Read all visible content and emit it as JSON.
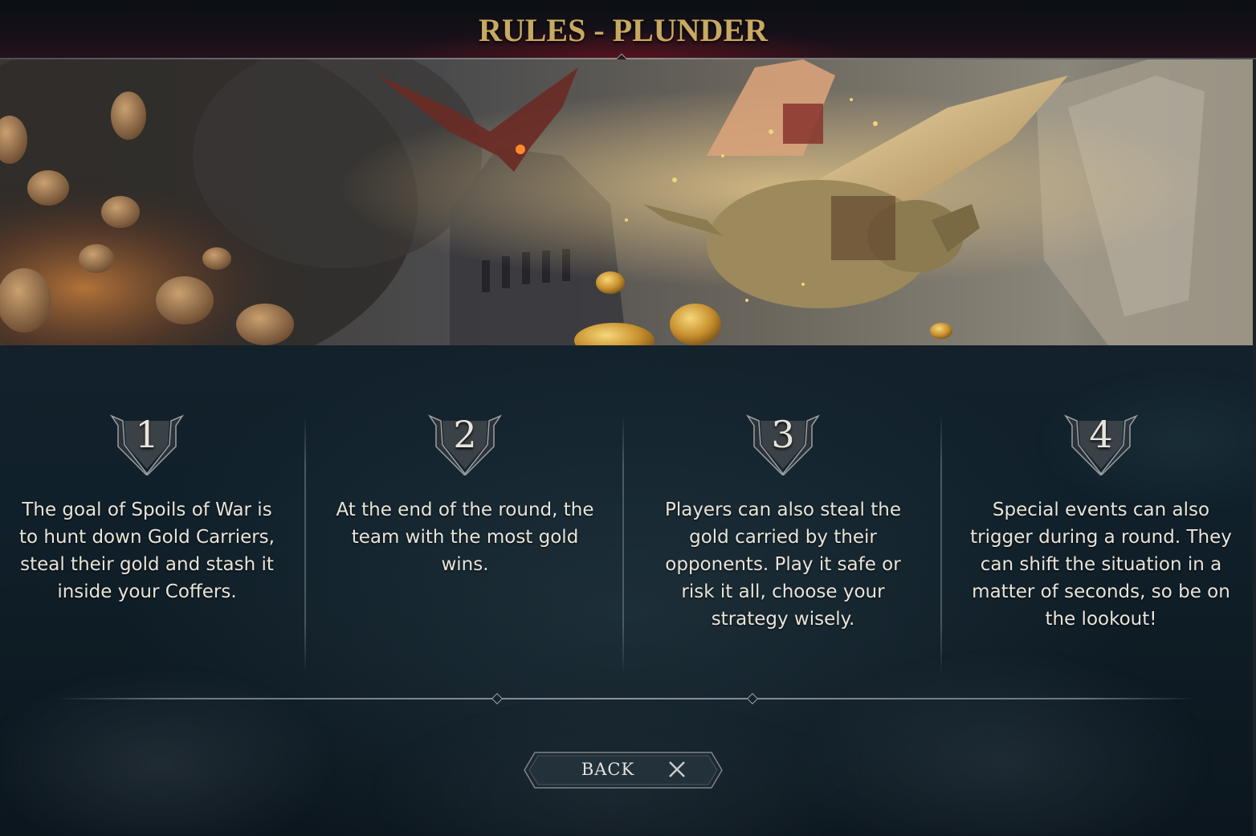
{
  "header": {
    "title": "RULES - PLUNDER"
  },
  "banner": {
    "description_icon": "dragon-gold-raid-art"
  },
  "rules": [
    {
      "number": "1",
      "text": "The goal of Spoils of War is to hunt down Gold Carriers, steal their gold and stash it inside your Coffers."
    },
    {
      "number": "2",
      "text": "At the end of the round, the team with the most gold wins."
    },
    {
      "number": "3",
      "text": "Players can also steal the gold carried by their opponents. Play it safe or risk it all, choose your strategy wisely."
    },
    {
      "number": "4",
      "text": "Special events can also trigger during a round. They can shift the situation in a matter of seconds, so be on the lookout!"
    }
  ],
  "footer": {
    "back_label": "BACK",
    "back_icon": "close-x-icon"
  },
  "colors": {
    "title_gold": "#c9a961",
    "text": "#e8e4da",
    "background": "#13212b"
  }
}
